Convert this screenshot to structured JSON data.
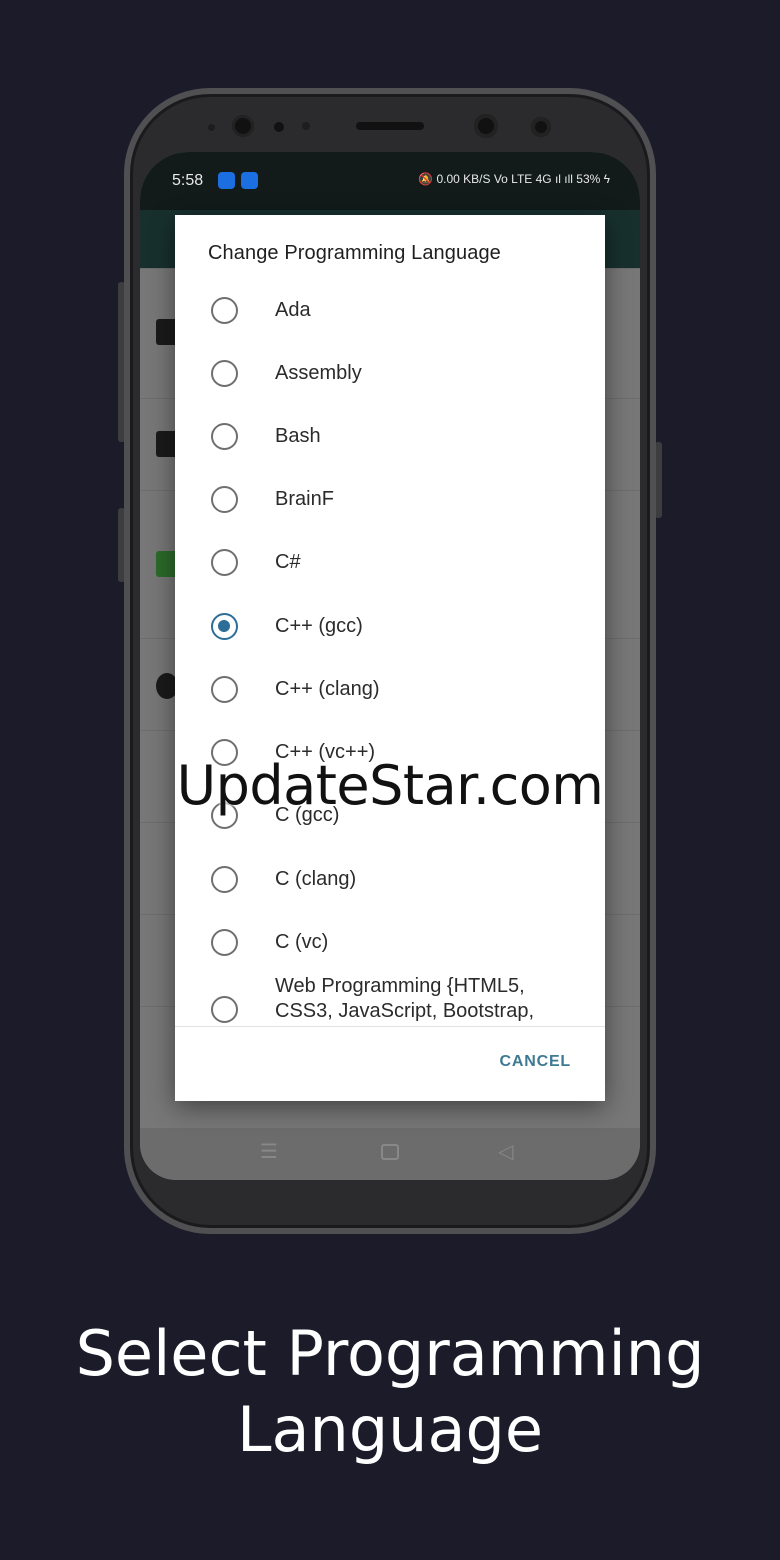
{
  "status_bar": {
    "time": "5:58",
    "right_indicators": "🔕 0.00 KB/S Vo LTE 4G ıl ıll 53% ϟ",
    "battery": "53%"
  },
  "dialog": {
    "title": "Change Programming Language",
    "options": [
      {
        "label": "Ada",
        "selected": false
      },
      {
        "label": "Assembly",
        "selected": false
      },
      {
        "label": "Bash",
        "selected": false
      },
      {
        "label": "BrainF",
        "selected": false
      },
      {
        "label": "C#",
        "selected": false
      },
      {
        "label": "C++ (gcc)",
        "selected": true
      },
      {
        "label": "C++ (clang)",
        "selected": false
      },
      {
        "label": "C++ (vc++)",
        "selected": false
      },
      {
        "label": "C (gcc)",
        "selected": false
      },
      {
        "label": "C (clang)",
        "selected": false
      },
      {
        "label": "C (vc)",
        "selected": false
      },
      {
        "label": "Web Programming {HTML5, CSS3, JavaScript, Bootstrap,",
        "selected": false
      }
    ],
    "cancel_label": "CANCEL"
  },
  "nav": {
    "menu_icon": "menu-icon",
    "home_icon": "home-icon",
    "back_icon": "back-icon"
  },
  "watermark": "UpdateStar.com",
  "caption": {
    "line1": "Select Programming",
    "line2": "Language"
  },
  "colors": {
    "background": "#1b1b2a",
    "accent": "#2c6e97",
    "cancel": "#3e7a92",
    "appbar": "#17302e"
  }
}
